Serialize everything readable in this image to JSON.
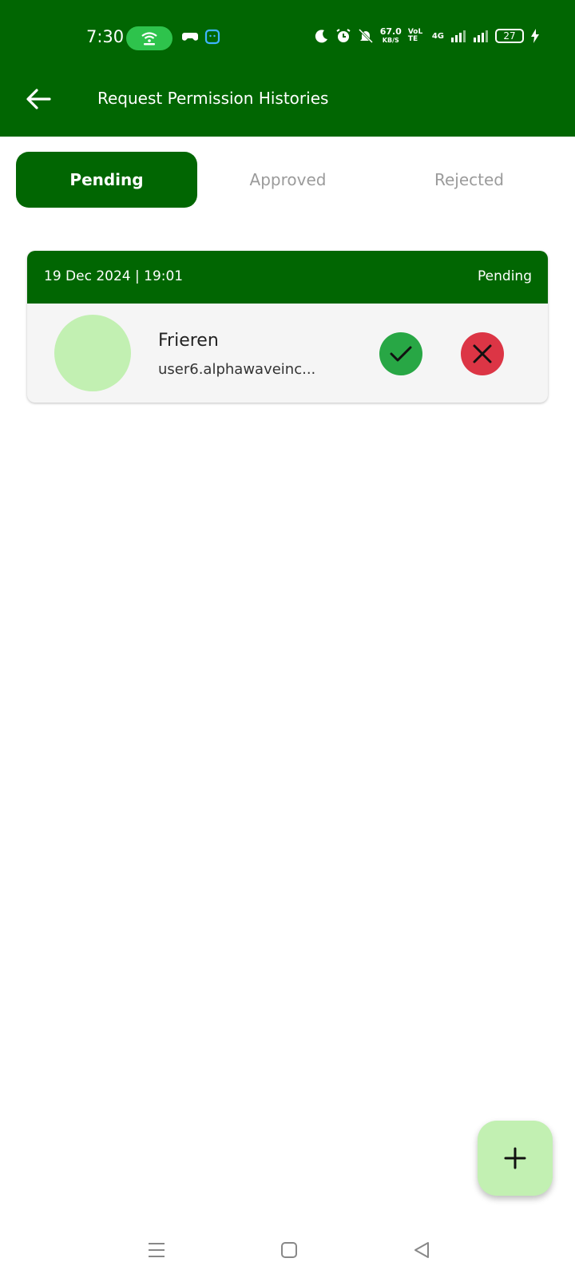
{
  "status_bar": {
    "time": "7:30",
    "net_speed_value": "67.0",
    "net_speed_unit": "KB/S",
    "volte": "VoLTE",
    "network": "4G",
    "battery": "27"
  },
  "header": {
    "title": "Request Permission Histories"
  },
  "tabs": [
    {
      "label": "Pending",
      "active": true
    },
    {
      "label": "Approved",
      "active": false
    },
    {
      "label": "Rejected",
      "active": false
    }
  ],
  "requests": [
    {
      "datetime": "19 Dec 2024 | 19:01",
      "status": "Pending",
      "name": "Frieren",
      "email": "user6.alphawaveinc..."
    }
  ],
  "colors": {
    "primary": "#016602",
    "approve": "#28a745",
    "reject": "#dc3545",
    "avatar": "#c2f0b2",
    "fab": "#c2f0b2"
  },
  "icons": {
    "back": "arrow-left-icon",
    "approve": "check-icon",
    "reject": "close-icon",
    "fab": "plus-icon"
  }
}
